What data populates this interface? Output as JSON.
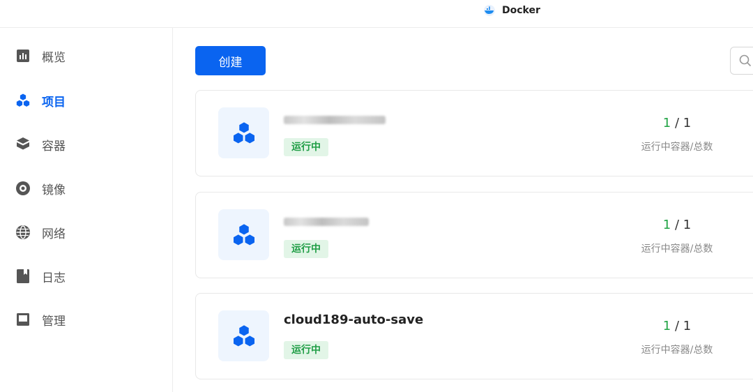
{
  "app": {
    "title": "Docker",
    "icon": "docker-icon"
  },
  "sidebar": {
    "items": [
      {
        "label": "概览",
        "icon": "chart-icon",
        "active": false
      },
      {
        "label": "项目",
        "icon": "cubes-icon",
        "active": true
      },
      {
        "label": "容器",
        "icon": "container-icon",
        "active": false
      },
      {
        "label": "镜像",
        "icon": "disc-icon",
        "active": false
      },
      {
        "label": "网络",
        "icon": "globe-icon",
        "active": false
      },
      {
        "label": "日志",
        "icon": "log-icon",
        "active": false
      },
      {
        "label": "管理",
        "icon": "manage-icon",
        "active": false
      }
    ]
  },
  "toolbar": {
    "create_label": "创建",
    "search_icon": "search-icon"
  },
  "projects": [
    {
      "name": "",
      "name_obscured": true,
      "status": "运行中",
      "running": "1",
      "total": "1",
      "separator": " / ",
      "count_label": "运行中容器/总数"
    },
    {
      "name": "",
      "name_obscured": true,
      "status": "运行中",
      "running": "1",
      "total": "1",
      "separator": " / ",
      "count_label": "运行中容器/总数"
    },
    {
      "name": "cloud189-auto-save",
      "name_obscured": false,
      "status": "运行中",
      "running": "1",
      "total": "1",
      "separator": " / ",
      "count_label": "运行中容器/总数"
    }
  ],
  "colors": {
    "accent": "#0a64f0",
    "running": "#20a344",
    "badge_bg": "#e2f5e7"
  }
}
